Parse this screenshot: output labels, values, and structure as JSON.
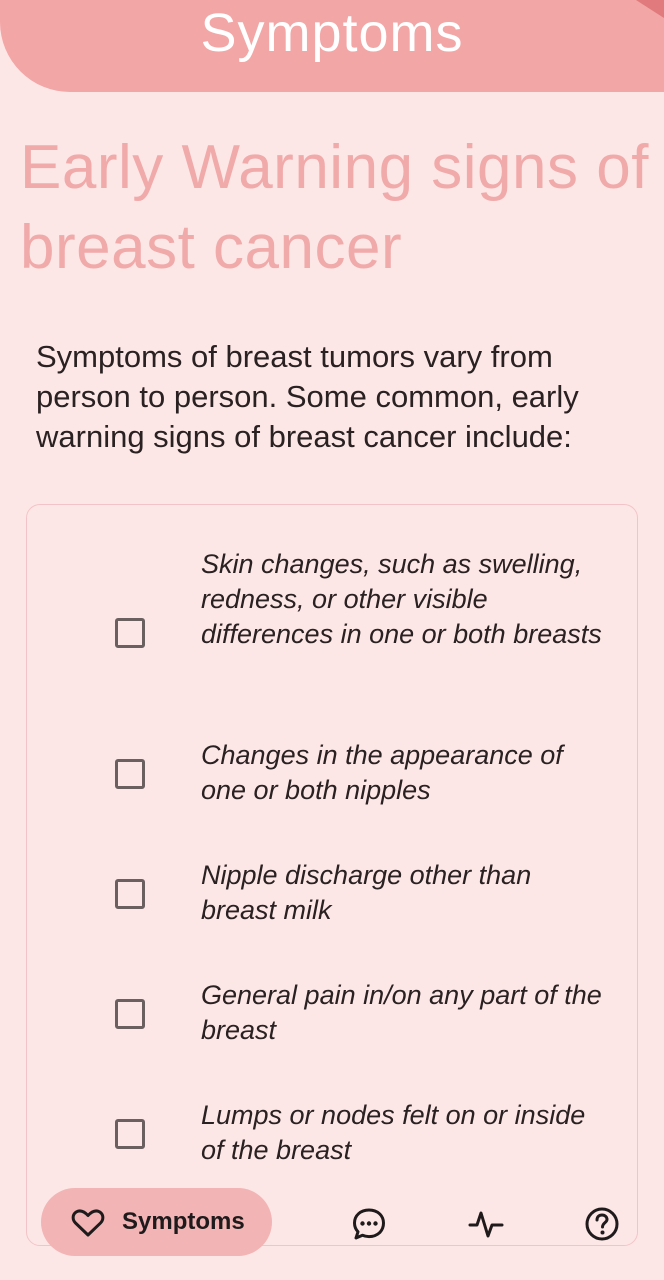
{
  "header": {
    "title": "Symptoms"
  },
  "main": {
    "heading": "Early Warning signs of breast cancer",
    "intro": "Symptoms of breast tumors vary from person to person. Some common, early warning signs of breast cancer include:"
  },
  "checklist": [
    {
      "text": "Skin changes, such as swelling, redness, or other visible differences in one or both breasts",
      "checked": false
    },
    {
      "text": "Changes in the appearance of one or both nipples",
      "checked": false
    },
    {
      "text": "Nipple discharge other than breast milk",
      "checked": false
    },
    {
      "text": "General pain in/on any part of the breast",
      "checked": false
    },
    {
      "text": "Lumps or nodes felt on or inside of the breast",
      "checked": false
    }
  ],
  "bottom_nav": {
    "active": {
      "label": "Symptoms",
      "icon": "heart-icon"
    },
    "items": [
      {
        "icon": "chat-bubble-icon"
      },
      {
        "icon": "activity-pulse-icon"
      },
      {
        "icon": "help-circle-icon"
      }
    ]
  },
  "colors": {
    "background": "#fde7e6",
    "header": "#f2a6a6",
    "heading_text": "#f0aaaa",
    "nav_active": "#f2b4b4"
  }
}
